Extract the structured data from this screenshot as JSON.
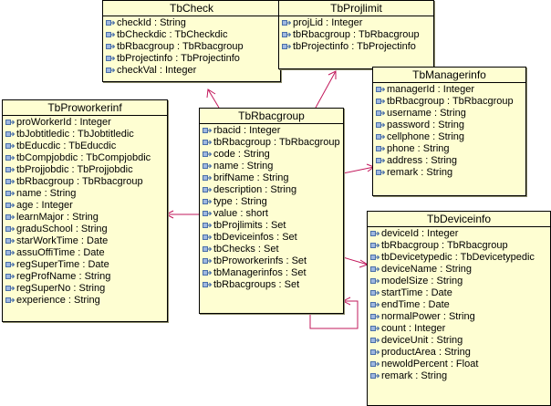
{
  "classes": {
    "tbcheck": {
      "name": "TbCheck",
      "attributes": [
        "checkId : String",
        "tbCheckdic : TbCheckdic",
        "tbRbacgroup : TbRbacgroup",
        "tbProjectinfo : TbProjectinfo",
        "checkVal : Integer"
      ]
    },
    "tbprojlimit": {
      "name": "TbProjlimit",
      "attributes": [
        "projLid : Integer",
        "tbRbacgroup : TbRbacgroup",
        "tbProjectinfo : TbProjectinfo"
      ]
    },
    "tbmanagerinfo": {
      "name": "TbManagerinfo",
      "attributes": [
        "managerId : Integer",
        "tbRbacgroup : TbRbacgroup",
        "username : String",
        "password : String",
        "cellphone : String",
        "phone : String",
        "address : String",
        "remark : String"
      ]
    },
    "tbproworkerinf": {
      "name": "TbProworkerinf",
      "attributes": [
        "proWorkerId : Integer",
        "tbJobtitledic : TbJobtitledic",
        "tbEducdic : TbEducdic",
        "tbCompjobdic : TbCompjobdic",
        "tbProjjobdic : TbProjjobdic",
        "tbRbacgroup : TbRbacgroup",
        "name : String",
        "age : Integer",
        "learnMajor : String",
        "graduSchool : String",
        "starWorkTime : Date",
        "assuOffiTime : Date",
        "regSuperTime : Date",
        "regProfName : String",
        "regSuperNo : String",
        "experience : String"
      ]
    },
    "tbrbacgroup": {
      "name": "TbRbacgroup",
      "attributes": [
        "rbacid : Integer",
        "tbRbacgroup : TbRbacgroup",
        "code : String",
        "name : String",
        "brifName : String",
        "description : String",
        "type : String",
        "value : short",
        "tbProjlimits : Set",
        "tbDeviceinfos : Set",
        "tbChecks : Set",
        "tbProworkerinfs : Set",
        "tbManagerinfos : Set",
        "tbRbacgroups : Set"
      ]
    },
    "tbdeviceinfo": {
      "name": "TbDeviceinfo",
      "attributes": [
        "deviceId : Integer",
        "tbRbacgroup : TbRbacgroup",
        "tbDevicetypedic : TbDevicetypedic",
        "deviceName : String",
        "modelSize : String",
        "startTime : Date",
        "endTime : Date",
        "normalPower : String",
        "count : Integer",
        "deviceUnit : String",
        "productArea : String",
        "newoldPercent : Float",
        "remark : String"
      ]
    }
  },
  "colors": {
    "class_fill": "#fefed2",
    "border": "#000000",
    "association_line": "#c2185b",
    "attribute_icon": "#4a6fa8"
  },
  "icon_name": "field-attribute-icon"
}
